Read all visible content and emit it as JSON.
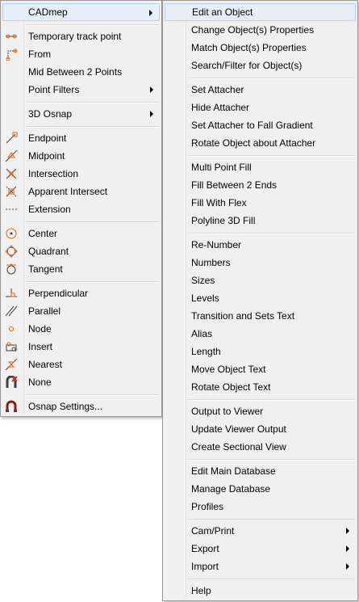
{
  "left_menu": {
    "items": [
      {
        "label": "CADmep",
        "submenu": true
      },
      {
        "label": "Temporary track point"
      },
      {
        "label": "From"
      },
      {
        "label": "Mid Between 2 Points"
      },
      {
        "label": "Point Filters",
        "submenu": true
      },
      {
        "label": "3D Osnap",
        "submenu": true
      },
      {
        "label": "Endpoint",
        "icon": "endpoint-icon"
      },
      {
        "label": "Midpoint",
        "icon": "midpoint-icon"
      },
      {
        "label": "Intersection",
        "icon": "intersection-icon"
      },
      {
        "label": "Apparent Intersect",
        "icon": "apparent-intersect-icon"
      },
      {
        "label": "Extension",
        "icon": "extension-icon"
      },
      {
        "label": "Center",
        "icon": "center-icon"
      },
      {
        "label": "Quadrant",
        "icon": "quadrant-icon"
      },
      {
        "label": "Tangent",
        "icon": "tangent-icon"
      },
      {
        "label": "Perpendicular",
        "icon": "perpendicular-icon"
      },
      {
        "label": "Parallel",
        "icon": "parallel-icon"
      },
      {
        "label": "Node",
        "icon": "node-icon"
      },
      {
        "label": "Insert",
        "icon": "insert-icon"
      },
      {
        "label": "Nearest",
        "icon": "nearest-icon"
      },
      {
        "label": "None",
        "icon": "none-icon"
      },
      {
        "label": "Osnap Settings...",
        "icon": "osnap-settings-icon"
      }
    ]
  },
  "right_menu": {
    "items": [
      {
        "label": "Edit an Object"
      },
      {
        "label": "Change Object(s) Properties"
      },
      {
        "label": "Match Object(s) Properties"
      },
      {
        "label": "Search/Filter for Object(s)"
      },
      {
        "label": "Set Attacher"
      },
      {
        "label": "Hide Attacher"
      },
      {
        "label": "Set Attacher to Fall Gradient"
      },
      {
        "label": "Rotate Object about Attacher"
      },
      {
        "label": "Multi Point Fill"
      },
      {
        "label": "Fill Between 2 Ends"
      },
      {
        "label": "Fill With Flex"
      },
      {
        "label": "Polyline 3D Fill"
      },
      {
        "label": "Re-Number"
      },
      {
        "label": "Numbers"
      },
      {
        "label": "Sizes"
      },
      {
        "label": "Levels"
      },
      {
        "label": "Transition and Sets Text"
      },
      {
        "label": "Alias"
      },
      {
        "label": "Length"
      },
      {
        "label": "Move Object Text"
      },
      {
        "label": "Rotate Object Text"
      },
      {
        "label": "Output to Viewer"
      },
      {
        "label": "Update Viewer Output"
      },
      {
        "label": "Create Sectional View"
      },
      {
        "label": "Edit Main Database"
      },
      {
        "label": "Manage Database"
      },
      {
        "label": "Profiles"
      },
      {
        "label": "Cam/Print",
        "submenu": true
      },
      {
        "label": "Export",
        "submenu": true
      },
      {
        "label": "Import",
        "submenu": true
      },
      {
        "label": "Help"
      }
    ]
  },
  "colors": {
    "menu_bg": "#f0f0f0",
    "icon_orange": "#d2691e",
    "icon_dark": "#404040",
    "icon_red": "#c0392b"
  }
}
